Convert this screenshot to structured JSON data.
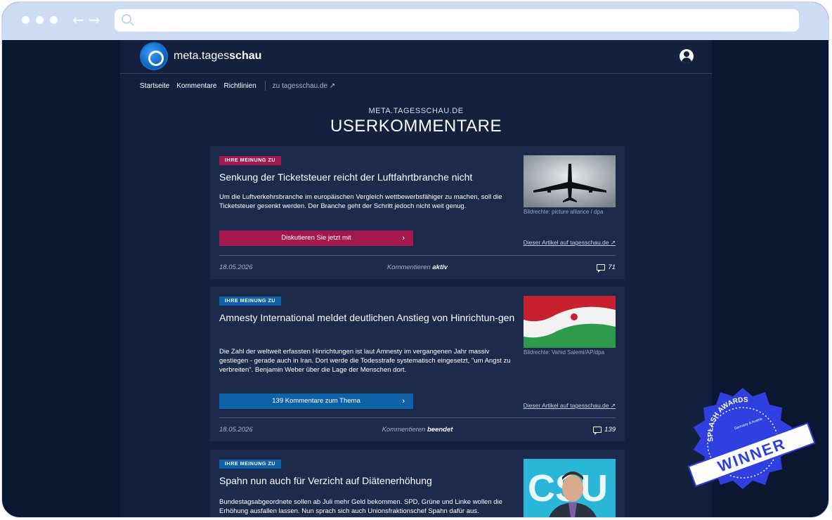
{
  "site": {
    "logo_prefix": "meta.tages",
    "logo_bold": "schau",
    "nav": [
      "Startseite",
      "Kommentare",
      "Richtlinien"
    ],
    "external_nav": "zu tagesschau.de",
    "kicker": "META.TAGESSCHAU.DE",
    "title": "USERKOMMENTARE"
  },
  "cards": [
    {
      "badge": "IHRE MEINUNG ZU",
      "badge_color": "#a3194f",
      "title": "Senkung der Ticketsteuer reicht der Luftfahrtbranche nicht",
      "text": "Um die Luftverkehrsbranche im europäischen Vergleich wettbewerbsfähiger zu machen, soll die Ticketsteuer gesenkt werden. Der Branche geht der Schritt jedoch nicht weit genug.",
      "credit": "Bildrechte: picture alliance / dpa",
      "cta": "Diskutieren Sie jetzt mit",
      "cta_color": "#a3194f",
      "ext_link": "Dieser Artikel auf tagesschau.de",
      "date": "18.05.2026",
      "status_prefix": "Kommentieren",
      "status": "aktiv",
      "count": "71"
    },
    {
      "badge": "IHRE MEINUNG ZU",
      "badge_color": "#1062a8",
      "title": "Amnesty International meldet deutlichen Anstieg von Hinrichtun-gen",
      "text": "Die Zahl der weltweit erfassten Hinrichtungen ist laut Amnesty im vergangenen Jahr massiv gestiegen - gerade auch in Iran. Dort werde die Todesstrafe systematisch eingesetzt, \"um Angst zu verbreiten\". Benjamin Weber über die Lage der Menschen dort.",
      "credit": "Bildrechte: Vahid Salemi/AP/dpa",
      "cta": "139 Kommentare zum Thema",
      "cta_color": "#1062a8",
      "ext_link": "Dieser Artikel auf tagesschau.de",
      "date": "18.05.2026",
      "status_prefix": "Kommentieren",
      "status": "beendet",
      "count": "139"
    },
    {
      "badge": "IHRE MEINUNG ZU",
      "badge_color": "#1062a8",
      "title": "Spahn nun auch für Verzicht auf Diätenerhöhung",
      "text": "Bundestagsabgeordnete sollen ab Juli mehr Geld bekommen. SPD, Grüne und Linke wollen die Erhöhung ausfallen lassen. Nun sprach sich auch Unionsfraktionschef Spahn dafür aus."
    }
  ],
  "award": {
    "line1": "SPLASH AWARDS",
    "line2": "Germany & Austria",
    "line3": "WINNER"
  }
}
